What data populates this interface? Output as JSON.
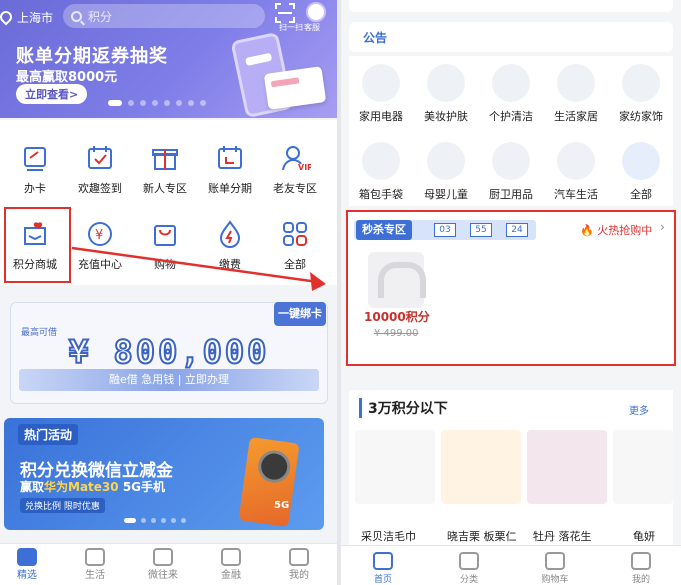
{
  "left": {
    "header": {
      "city": "上海市",
      "search_placeholder": "积分",
      "scan_label": "扫一扫",
      "service_label": "客服"
    },
    "banner": {
      "title": "账单分期返券抽奖",
      "subtitle": "最高赢取8000元",
      "cta": "立即查看>"
    },
    "grid": [
      {
        "label": "办卡",
        "icon": "card-icon"
      },
      {
        "label": "欢趣签到",
        "icon": "calendar-check-icon"
      },
      {
        "label": "新人专区",
        "icon": "gift-icon"
      },
      {
        "label": "账单分期",
        "icon": "bill-calendar-icon"
      },
      {
        "label": "老友专区",
        "icon": "vip-user-icon"
      },
      {
        "label": "积分商城",
        "icon": "points-mall-icon"
      },
      {
        "label": "充值中心",
        "icon": "yen-circle-icon"
      },
      {
        "label": "购物",
        "icon": "shopping-bag-icon"
      },
      {
        "label": "缴费",
        "icon": "flame-drop-icon"
      },
      {
        "label": "全部",
        "icon": "grid-all-icon"
      }
    ],
    "credit": {
      "label": "最高可借",
      "amount": "¥ 800,000",
      "bar_text": "融e借 急用钱 | 立即办理",
      "bind_button": "一键绑卡"
    },
    "promo": {
      "tag": "热门活动",
      "line1": "积分兑换微信立减金",
      "line2_prefix": "赢取",
      "line2_highlight": "华为Mate30",
      "line2_suffix": " 5G手机",
      "line3": "兑换比例 限时优惠",
      "phone_tag": "5G"
    },
    "tabbar": [
      {
        "label": "精选"
      },
      {
        "label": "生活"
      },
      {
        "label": "微往来"
      },
      {
        "label": "金融"
      },
      {
        "label": "我的"
      }
    ]
  },
  "right": {
    "notice_label": "公告",
    "categories": [
      {
        "label": "家用电器",
        "icon": "microwave-icon"
      },
      {
        "label": "美妆护肤",
        "icon": "lipstick-icon"
      },
      {
        "label": "个护清洁",
        "icon": "cleaning-bottle-icon"
      },
      {
        "label": "生活家居",
        "icon": "armchair-icon"
      },
      {
        "label": "家纺家饰",
        "icon": "pillow-icon"
      },
      {
        "label": "箱包手袋",
        "icon": "backpack-icon"
      },
      {
        "label": "母婴儿童",
        "icon": "baby-bottle-icon"
      },
      {
        "label": "厨卫用品",
        "icon": "range-hood-icon"
      },
      {
        "label": "汽车生活",
        "icon": "car-pillow-icon"
      },
      {
        "label": "全部",
        "icon": "grid-all-icon"
      }
    ],
    "flash": {
      "title": "秒杀专区",
      "timer": [
        "03",
        "55",
        "24"
      ],
      "status": "火热抢购中",
      "points": "10000积分",
      "original_price": "¥ 499.00"
    },
    "section": {
      "title": "3万积分以下",
      "more": "更多",
      "products": [
        "采贝洁毛巾",
        "晓吉栗 板栗仁",
        "牡丹 落花生",
        "龟妍"
      ]
    },
    "tabbar": [
      {
        "label": "首页"
      },
      {
        "label": "分类"
      },
      {
        "label": "购物车"
      },
      {
        "label": "我的"
      }
    ]
  },
  "colors": {
    "accent": "#3d6fd6",
    "highlight_red": "#e0312f",
    "banner_purple": "#7f7ee8"
  }
}
